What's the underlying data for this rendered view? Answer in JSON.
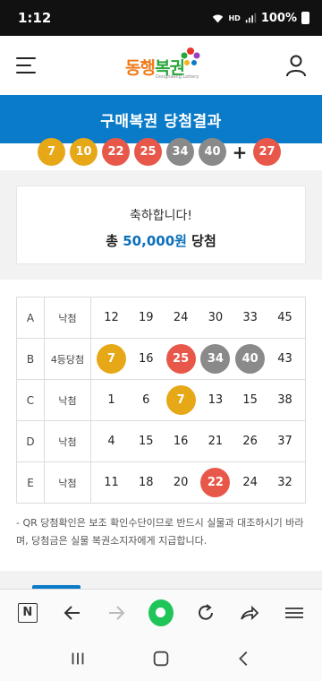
{
  "status_bar": {
    "time": "1:12",
    "battery": "100%",
    "network": "HD"
  },
  "header": {
    "logo": {
      "text_1": "동행",
      "text_2": "복권",
      "subtitle": "Donghaeng Lottery"
    },
    "menu_icon": "hamburger-menu-icon",
    "user_icon": "user-profile-icon"
  },
  "title_bar": {
    "title": "구매복권 당첨결과"
  },
  "winning_numbers": {
    "balls": [
      {
        "value": "7",
        "color": "#e6a817"
      },
      {
        "value": "10",
        "color": "#e6a817"
      },
      {
        "value": "22",
        "color": "#e8584a"
      },
      {
        "value": "25",
        "color": "#e8584a"
      },
      {
        "value": "34",
        "color": "#8a8a8a"
      },
      {
        "value": "40",
        "color": "#8a8a8a"
      }
    ],
    "plus": "+",
    "bonus": {
      "value": "27",
      "color": "#e8584a"
    }
  },
  "congrats": {
    "message": "축하합니다!",
    "prefix": "총",
    "amount": "50,000원",
    "suffix": "당첨"
  },
  "results": [
    {
      "game": "A",
      "result": "낙첨",
      "numbers": [
        {
          "v": "12"
        },
        {
          "v": "19"
        },
        {
          "v": "24"
        },
        {
          "v": "30"
        },
        {
          "v": "33"
        },
        {
          "v": "45"
        }
      ]
    },
    {
      "game": "B",
      "result": "4등당첨",
      "numbers": [
        {
          "v": "7",
          "color": "#e6a817"
        },
        {
          "v": "16"
        },
        {
          "v": "25",
          "color": "#e8584a"
        },
        {
          "v": "34",
          "color": "#8a8a8a"
        },
        {
          "v": "40",
          "color": "#8a8a8a"
        },
        {
          "v": "43"
        }
      ]
    },
    {
      "game": "C",
      "result": "낙첨",
      "numbers": [
        {
          "v": "1"
        },
        {
          "v": "6"
        },
        {
          "v": "7",
          "color": "#e6a817"
        },
        {
          "v": "13"
        },
        {
          "v": "15"
        },
        {
          "v": "38"
        }
      ]
    },
    {
      "game": "D",
      "result": "낙첨",
      "numbers": [
        {
          "v": "4"
        },
        {
          "v": "15"
        },
        {
          "v": "16"
        },
        {
          "v": "21"
        },
        {
          "v": "26"
        },
        {
          "v": "37"
        }
      ]
    },
    {
      "game": "E",
      "result": "낙첨",
      "numbers": [
        {
          "v": "11"
        },
        {
          "v": "18"
        },
        {
          "v": "20"
        },
        {
          "v": "22",
          "color": "#e8584a"
        },
        {
          "v": "24"
        },
        {
          "v": "32"
        }
      ]
    }
  ],
  "note": "- QR 당첨확인은 보조 확인수단이므로 반드시 실물과 대조하시기 바라며, 당첨금은 실물 복권소지자에게 지급합니다.",
  "browser_toolbar": {
    "items": [
      "n-tab-icon",
      "back-arrow-icon",
      "forward-arrow-icon",
      "home-green-icon",
      "refresh-icon",
      "share-icon",
      "more-menu-icon"
    ]
  },
  "nav_bar": {
    "items": [
      "recent-apps-icon",
      "home-icon",
      "back-icon"
    ]
  }
}
